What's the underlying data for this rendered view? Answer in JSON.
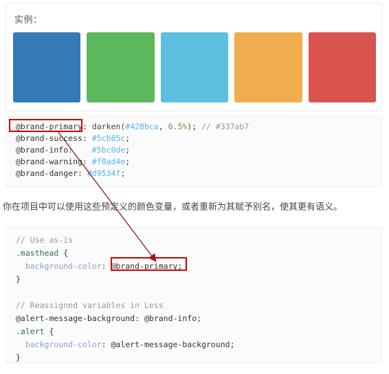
{
  "example": {
    "title": "实例：",
    "swatches": [
      {
        "name": "brand-primary",
        "color": "#337ab7"
      },
      {
        "name": "brand-success",
        "color": "#5cb85c"
      },
      {
        "name": "brand-info",
        "color": "#5bc0de"
      },
      {
        "name": "brand-warning",
        "color": "#f0ad4e"
      },
      {
        "name": "brand-danger",
        "color": "#d9534f"
      }
    ]
  },
  "variables_code": {
    "line1": {
      "var": "@brand-primary",
      "colon": ": ",
      "fn_open": "darken(",
      "hex": "#428bca",
      "sep": ", ",
      "pct": "6.5%",
      "fn_close": ");",
      "comment": " // #337ab7"
    },
    "line2": {
      "var": "@brand-success",
      "colon": ": ",
      "hex": "#5cb85c",
      "semi": ";"
    },
    "line3": {
      "var": "@brand-info",
      "colon": ":    ",
      "hex": "#5bc0de",
      "semi": ";"
    },
    "line4": {
      "var": "@brand-warning",
      "colon": ": ",
      "hex": "#f0ad4e",
      "semi": ";"
    },
    "line5": {
      "var": "@brand-danger",
      "colon": ": ",
      "hex": "#d9534f",
      "semi": ";"
    }
  },
  "note": {
    "text": "你在项目中可以使用这些预定义的颜色变量，或者重新为其赋予别名，使其更有语义。"
  },
  "usage_code": {
    "comment1": "// Use as-is",
    "selector1": ".masthead",
    "open1": " {",
    "prop1": "  background-color",
    "colon1": ": ",
    "value1": "@brand-primary;",
    "close1": "}",
    "blank": "",
    "comment2": "// Reassigned variables in Less",
    "assign_var": "@alert-message-background",
    "assign_colon": ": ",
    "assign_value": "@brand-info;",
    "selector2": ".alert",
    "open2": " {",
    "prop2": "  background-color",
    "colon2": ": ",
    "value2": "@alert-message-background;",
    "close2": "}"
  },
  "annotations": {
    "highlight_color": "#d40000",
    "arrow_color": "#8b1a1a",
    "box1_label": "@brand-primary",
    "box2_label": "@brand-primary;"
  }
}
